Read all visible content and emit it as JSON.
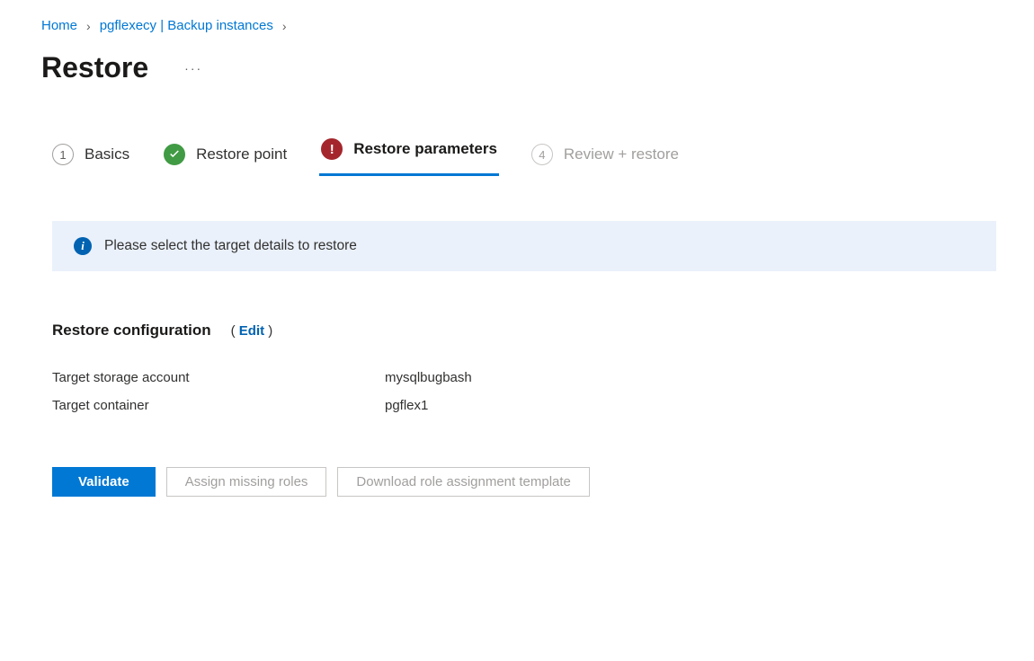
{
  "breadcrumb": {
    "home": "Home",
    "backup_instances": "pgflexecy | Backup instances"
  },
  "page_title": "Restore",
  "stepper": {
    "basics": {
      "num": "1",
      "label": "Basics"
    },
    "restore_point": {
      "label": "Restore point"
    },
    "restore_params": {
      "label": "Restore parameters"
    },
    "review": {
      "num": "4",
      "label": "Review + restore"
    }
  },
  "info_banner": {
    "text": "Please select the target details to restore"
  },
  "section": {
    "title": "Restore configuration",
    "edit_label": "Edit"
  },
  "config": {
    "target_storage_account": {
      "label": "Target storage account",
      "value": "mysqlbugbash"
    },
    "target_container": {
      "label": "Target container",
      "value": "pgflex1"
    }
  },
  "buttons": {
    "validate": "Validate",
    "assign_roles": "Assign missing roles",
    "download_template": "Download role assignment template"
  }
}
